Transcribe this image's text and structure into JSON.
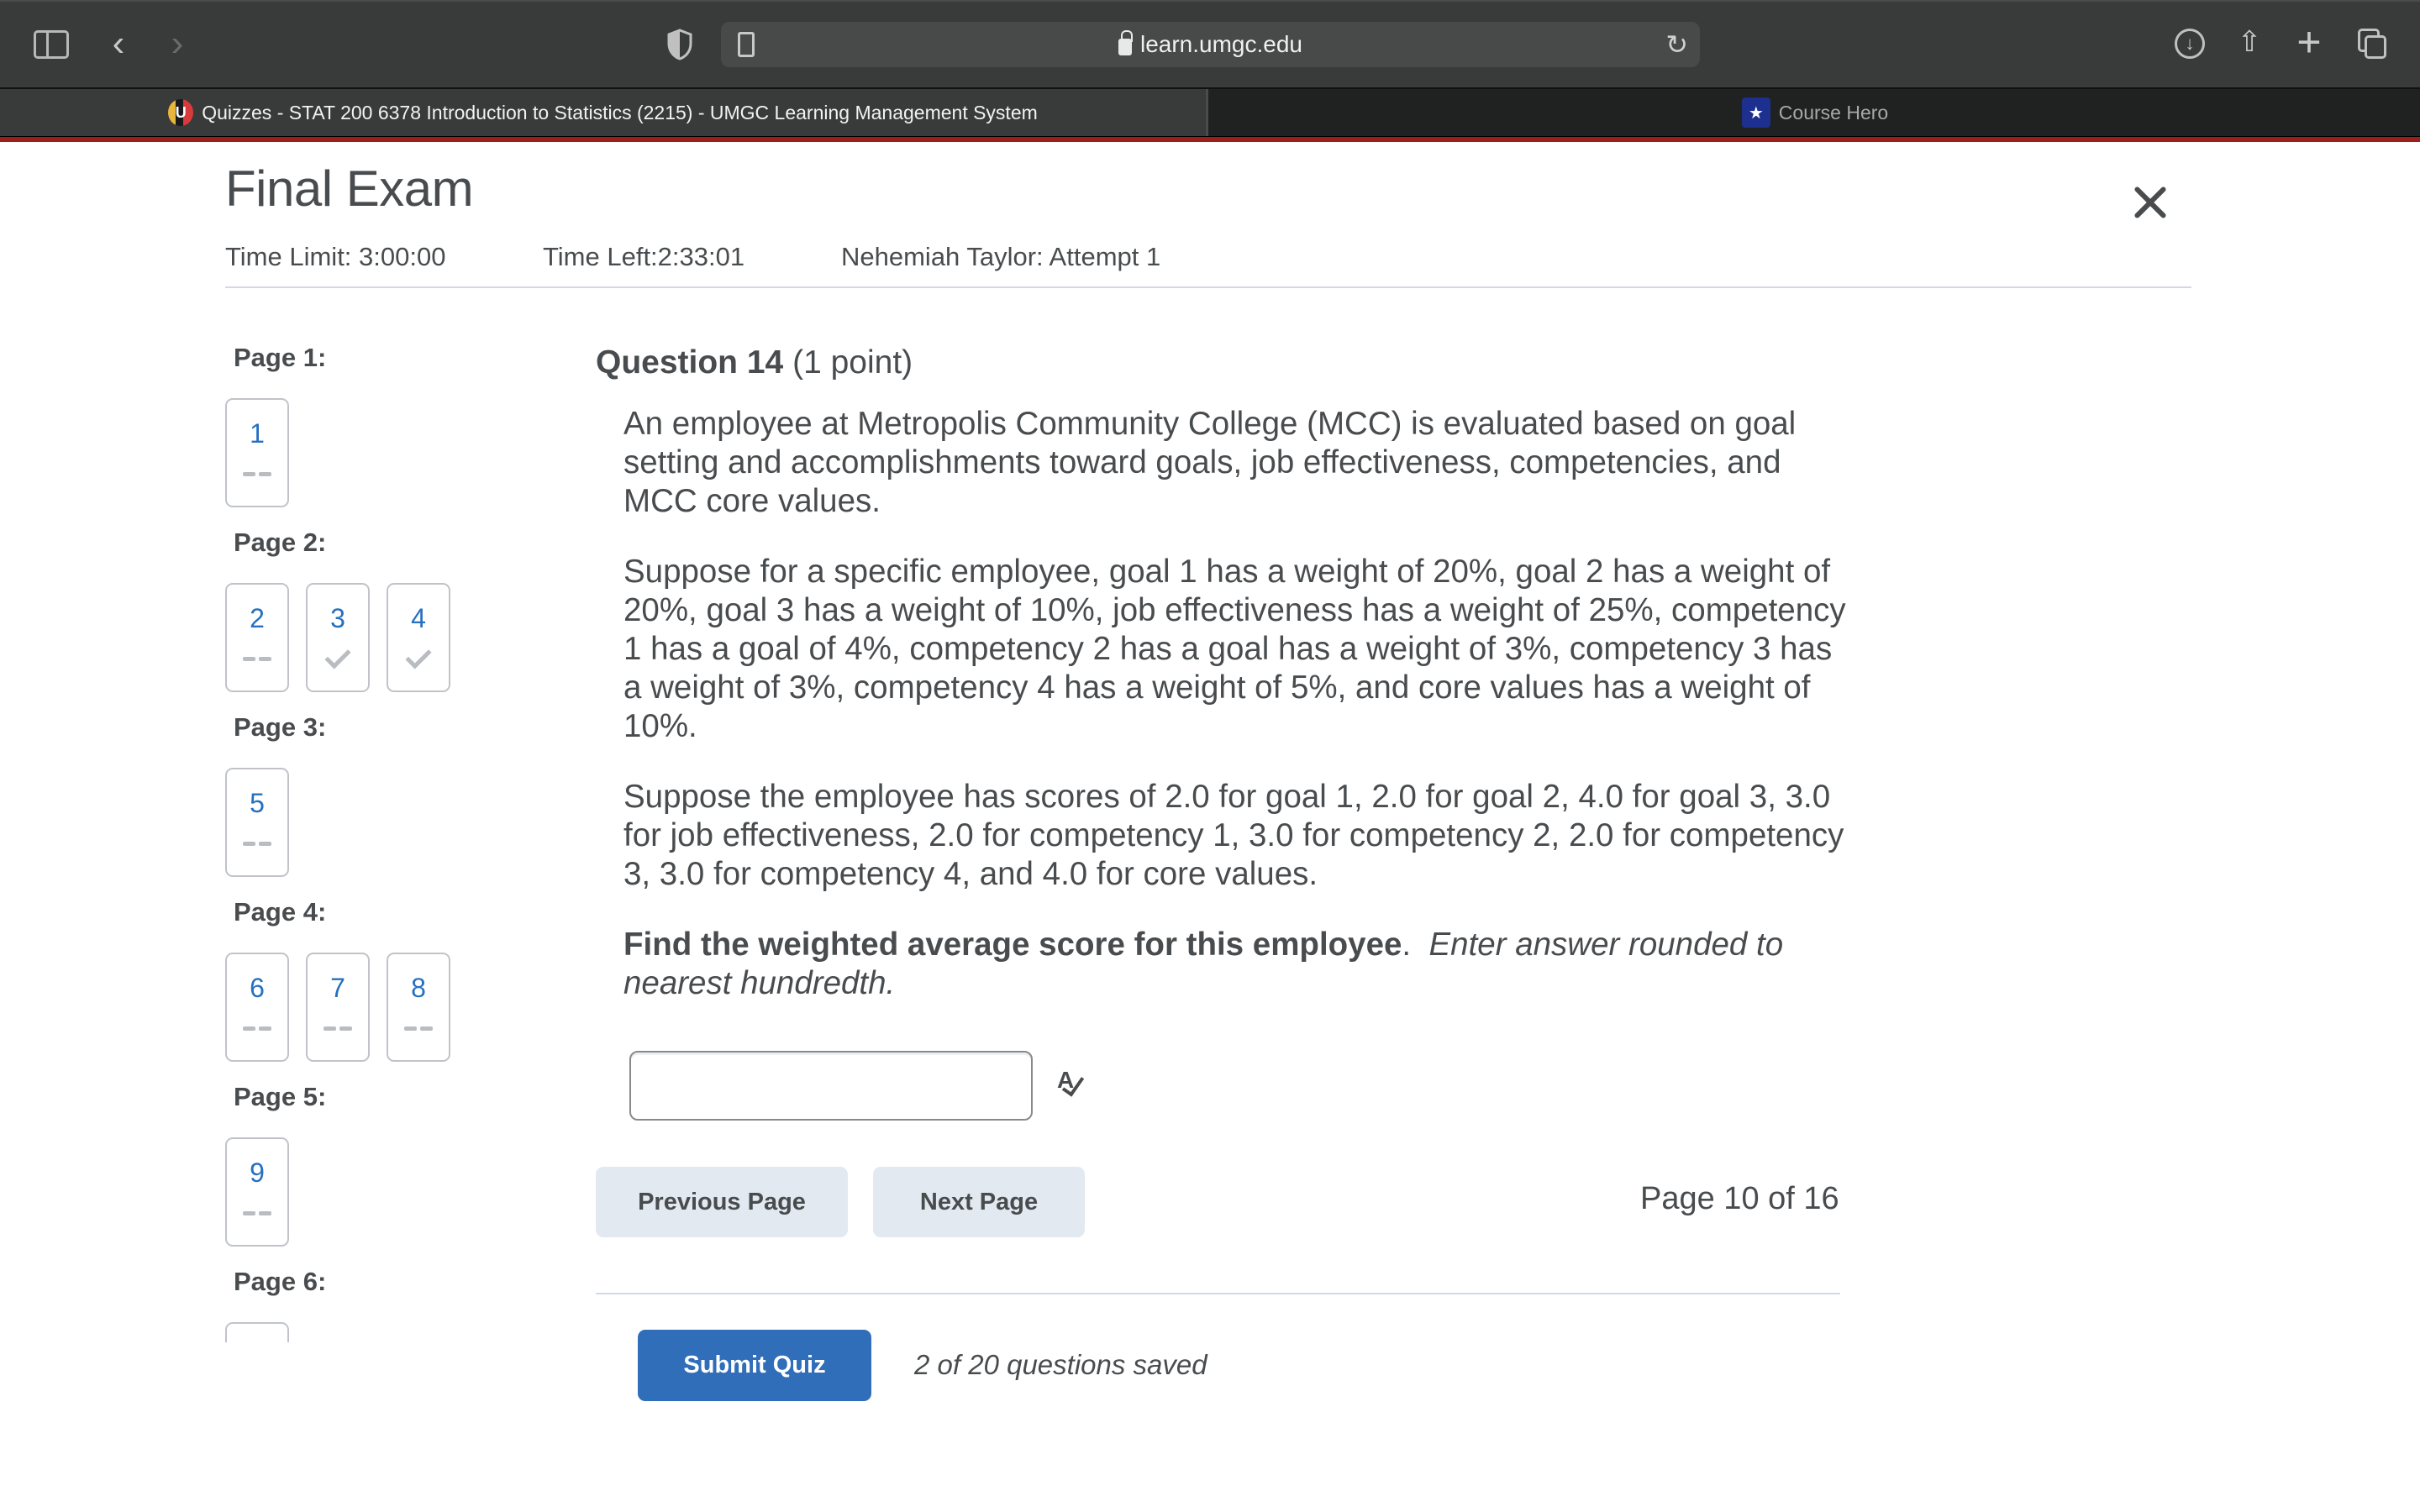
{
  "browser": {
    "url": "learn.umgc.edu",
    "tabs": [
      {
        "title": "Quizzes - STAT 200 6378 Introduction to Statistics (2215) - UMGC Learning Management System",
        "favicon": "umgc-logo-icon",
        "active": true
      },
      {
        "title": "Course Hero",
        "favicon": "course-hero-icon",
        "active": false
      }
    ],
    "icons": {
      "back": "‹",
      "forward": "›",
      "reload": "↻",
      "download": "↓",
      "share": "⇧",
      "new_tab": "+",
      "umgc_letter": "U",
      "ch_star": "★"
    },
    "accent_color": "#9b1f1a"
  },
  "header": {
    "title": "Final Exam",
    "time_limit": "Time Limit: 3:00:00",
    "time_left": "Time Left:2:33:01",
    "attempt": "Nehemiah Taylor: Attempt 1"
  },
  "sidebar": {
    "pages": [
      {
        "label": "Page 1:",
        "questions": [
          {
            "num": "1",
            "status": "unanswered"
          }
        ]
      },
      {
        "label": "Page 2:",
        "questions": [
          {
            "num": "2",
            "status": "unanswered"
          },
          {
            "num": "3",
            "status": "saved"
          },
          {
            "num": "4",
            "status": "saved"
          }
        ]
      },
      {
        "label": "Page 3:",
        "questions": [
          {
            "num": "5",
            "status": "unanswered"
          }
        ]
      },
      {
        "label": "Page 4:",
        "questions": [
          {
            "num": "6",
            "status": "unanswered"
          },
          {
            "num": "7",
            "status": "unanswered"
          },
          {
            "num": "8",
            "status": "unanswered"
          }
        ]
      },
      {
        "label": "Page 5:",
        "questions": [
          {
            "num": "9",
            "status": "unanswered"
          }
        ]
      },
      {
        "label": "Page 6:",
        "questions": [
          {
            "num": "",
            "status": "unanswered"
          }
        ]
      }
    ]
  },
  "question": {
    "title": "Question 14",
    "points": "(1 point)",
    "paragraphs": [
      "An employee at Metropolis Community College (MCC) is evaluated based on goal setting and accomplishments toward goals, job effectiveness, competencies, and MCC core values.",
      "Suppose for a specific employee, goal 1 has a weight of 20%, goal 2 has a weight of 20%, goal 3 has a weight of 10%, job effectiveness has a weight of 25%, competency 1 has a goal of 4%, competency 2 has a goal has a weight of 3%, competency 3 has a weight of 3%, competency 4 has a weight of 5%, and core values has a weight of 10%.",
      "Suppose the employee has scores of 2.0 for goal 1, 2.0 for goal 2, 4.0 for goal 3, 3.0 for job effectiveness, 2.0 for competency 1, 3.0 for competency 2, 2.0 for competency 3, 3.0 for competency 4, and 4.0 for core values."
    ],
    "prompt_bold": "Find the weighted average score for this employee",
    "prompt_bold_end": ".",
    "prompt_italic": "Enter answer rounded to nearest hundredth.",
    "answer_value": "",
    "spellcheck_glyph": "A"
  },
  "navigation": {
    "previous_label": "Previous Page",
    "next_label": "Next Page",
    "page_indicator": "Page 10 of 16"
  },
  "footer": {
    "submit_label": "Submit Quiz",
    "saved_status": "2 of 20 questions saved",
    "submit_color": "#306eb9"
  }
}
